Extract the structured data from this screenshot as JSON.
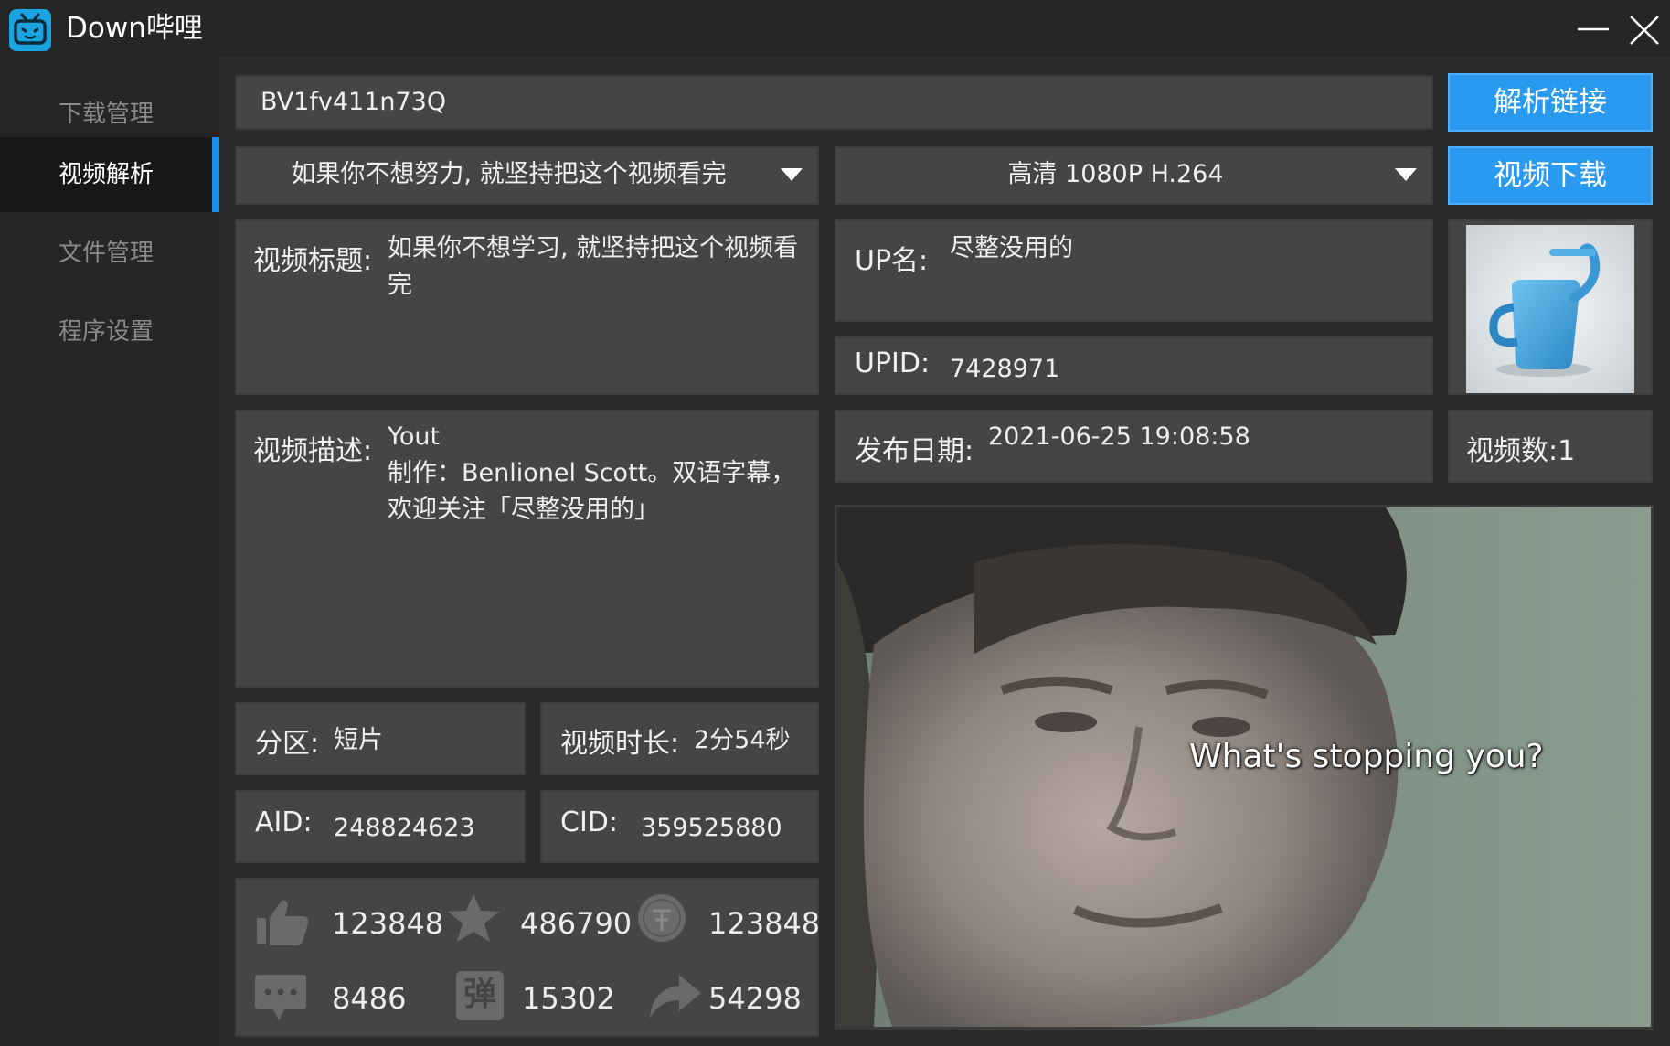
{
  "window": {
    "title": "Down哔哩",
    "logo_icon": "bilibili-tv-icon",
    "minimize_icon": "minimize-icon",
    "close_icon": "close-icon"
  },
  "sidebar": {
    "items": [
      {
        "label": "下载管理",
        "active": false
      },
      {
        "label": "视频解析",
        "active": true
      },
      {
        "label": "文件管理",
        "active": false
      },
      {
        "label": "程序设置",
        "active": false
      }
    ]
  },
  "search": {
    "value": "BV1fv411n73Q",
    "parse_button": "解析链接"
  },
  "selectors": {
    "episode_selected": "如果你不想努力, 就坚持把这个视频看完",
    "quality_selected": "高清 1080P H.264",
    "download_button": "视频下载"
  },
  "info": {
    "title_label": "视频标题:",
    "title_value": "如果你不想学习, 就坚持把这个视频看完",
    "up_label": "UP名:",
    "up_value": "尽整没用的",
    "upid_label": "UPID:",
    "upid_value": "7428971",
    "desc_label": "视频描述:",
    "desc_lines": [
      "Yout",
      "制作：Benlionel Scott。双语字幕，",
      "欢迎关注「尽整没用的」"
    ],
    "date_label": "发布日期:",
    "date_value": "2021-06-25 19:08:58",
    "video_count": "视频数:1",
    "zone_label": "分区:",
    "zone_value": "短片",
    "duration_label": "视频时长:",
    "duration_value": "2分54秒",
    "aid_label": "AID:",
    "aid_value": "248824623",
    "cid_label": "CID:",
    "cid_value": "359525880"
  },
  "stats": {
    "likes": "123848",
    "favorites": "486790",
    "coins": "123848",
    "replies": "8486",
    "danmaku": "15302",
    "danmaku_icon_text": "弹",
    "shares": "54298"
  },
  "preview": {
    "caption": "What's stopping you?"
  },
  "colors": {
    "accent": "#2a9af0",
    "panel": "#454545",
    "background": "#2b2b2b",
    "sidebar": "#262626"
  }
}
